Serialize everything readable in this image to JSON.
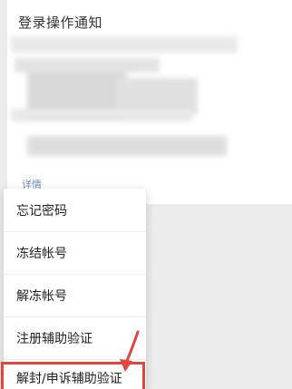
{
  "notice": {
    "title": "登录操作通知",
    "detail_link": "详情"
  },
  "menu": {
    "items": [
      {
        "label": "忘记密码"
      },
      {
        "label": "冻结帐号"
      },
      {
        "label": "解冻帐号"
      },
      {
        "label": "注册辅助验证"
      },
      {
        "label": "解封/申诉辅助验证"
      }
    ],
    "highlighted_index": 4
  },
  "colors": {
    "highlight": "#e0453e",
    "link": "#6a8fbf",
    "background": "#ececec"
  }
}
